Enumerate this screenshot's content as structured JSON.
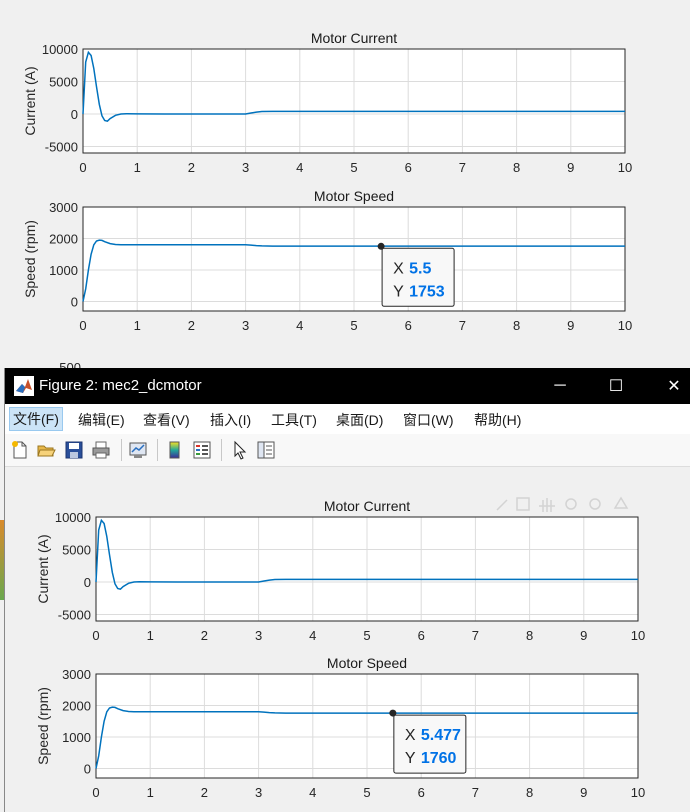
{
  "background_figure": {
    "plots": [
      {
        "title": "Motor Current",
        "ylabel": "Current (A)",
        "yticks": [
          "10000",
          "5000",
          "0",
          "-5000"
        ],
        "xticks": [
          "0",
          "1",
          "2",
          "3",
          "4",
          "5",
          "6",
          "7",
          "8",
          "9",
          "10"
        ]
      },
      {
        "title": "Motor Speed",
        "ylabel": "Speed (rpm)",
        "yticks": [
          "3000",
          "2000",
          "1000",
          "0"
        ],
        "xticks": [
          "0",
          "1",
          "2",
          "3",
          "4",
          "5",
          "6",
          "7",
          "8",
          "9",
          "10"
        ],
        "datatip": {
          "x_label": "X",
          "x_value": "5.5",
          "y_label": "Y",
          "y_value": "1753"
        }
      }
    ],
    "partial_tick": "500"
  },
  "window": {
    "title": "Figure 2: mec2_dcmotor",
    "controls": {
      "minimize": "─",
      "maximize": "☐",
      "close": "✕"
    },
    "menu": [
      "文件(F)",
      "编辑(E)",
      "查看(V)",
      "插入(I)",
      "工具(T)",
      "桌面(D)",
      "窗口(W)",
      "帮助(H)"
    ],
    "toolbar_icons": [
      "new-figure-icon",
      "open-file-icon",
      "save-icon",
      "print-icon",
      "link-plot-icon",
      "colorbar-icon",
      "legend-icon",
      "edit-plot-cursor-icon",
      "property-inspector-icon"
    ],
    "plots": [
      {
        "title": "Motor Current",
        "ylabel": "Current (A)",
        "yticks": [
          "10000",
          "5000",
          "0",
          "-5000"
        ],
        "xticks": [
          "0",
          "1",
          "2",
          "3",
          "4",
          "5",
          "6",
          "7",
          "8",
          "9",
          "10"
        ]
      },
      {
        "title": "Motor Speed",
        "ylabel": "Speed (rpm)",
        "yticks": [
          "3000",
          "2000",
          "1000",
          "0"
        ],
        "xticks": [
          "0",
          "1",
          "2",
          "3",
          "4",
          "5",
          "6",
          "7",
          "8",
          "9",
          "10"
        ],
        "datatip": {
          "x_label": "X",
          "x_value": "5.477",
          "y_label": "Y",
          "y_value": "1760"
        }
      }
    ]
  },
  "colors": {
    "line": "#0072bd",
    "datatip_value": "#0072e6",
    "grid": "#dcdcdc"
  },
  "chart_data": [
    {
      "type": "line",
      "title": "Motor Current",
      "xlabel": "",
      "ylabel": "Current (A)",
      "xlim": [
        0,
        10
      ],
      "ylim": [
        -6000,
        10000
      ],
      "grid": true,
      "x": [
        0,
        0.05,
        0.1,
        0.15,
        0.2,
        0.25,
        0.3,
        0.35,
        0.4,
        0.45,
        0.5,
        0.6,
        0.7,
        0.8,
        1.0,
        1.5,
        2.0,
        2.5,
        3.0,
        3.1,
        3.2,
        3.3,
        3.5,
        4,
        5,
        6,
        7,
        8,
        9,
        10
      ],
      "values": [
        0,
        8000,
        9500,
        9000,
        7000,
        4200,
        1500,
        -300,
        -1000,
        -1100,
        -700,
        -200,
        0,
        40,
        20,
        0,
        0,
        0,
        0,
        150,
        300,
        380,
        400,
        400,
        400,
        400,
        400,
        400,
        400,
        400
      ]
    },
    {
      "type": "line",
      "title": "Motor Speed",
      "xlabel": "",
      "ylabel": "Speed (rpm)",
      "xlim": [
        0,
        10
      ],
      "ylim": [
        -300,
        3000
      ],
      "grid": true,
      "x": [
        0,
        0.05,
        0.1,
        0.15,
        0.2,
        0.25,
        0.3,
        0.35,
        0.4,
        0.5,
        0.6,
        0.7,
        0.8,
        1.0,
        1.5,
        2.0,
        2.5,
        3.0,
        3.1,
        3.2,
        3.3,
        3.5,
        4,
        5,
        5.477,
        6,
        7,
        8,
        9,
        10
      ],
      "values": [
        0,
        400,
        1000,
        1500,
        1800,
        1920,
        1950,
        1940,
        1900,
        1840,
        1810,
        1805,
        1805,
        1805,
        1805,
        1805,
        1805,
        1805,
        1790,
        1775,
        1765,
        1760,
        1760,
        1760,
        1760,
        1760,
        1760,
        1760,
        1760,
        1760
      ],
      "datatip": {
        "x": 5.477,
        "y": 1760
      }
    }
  ]
}
